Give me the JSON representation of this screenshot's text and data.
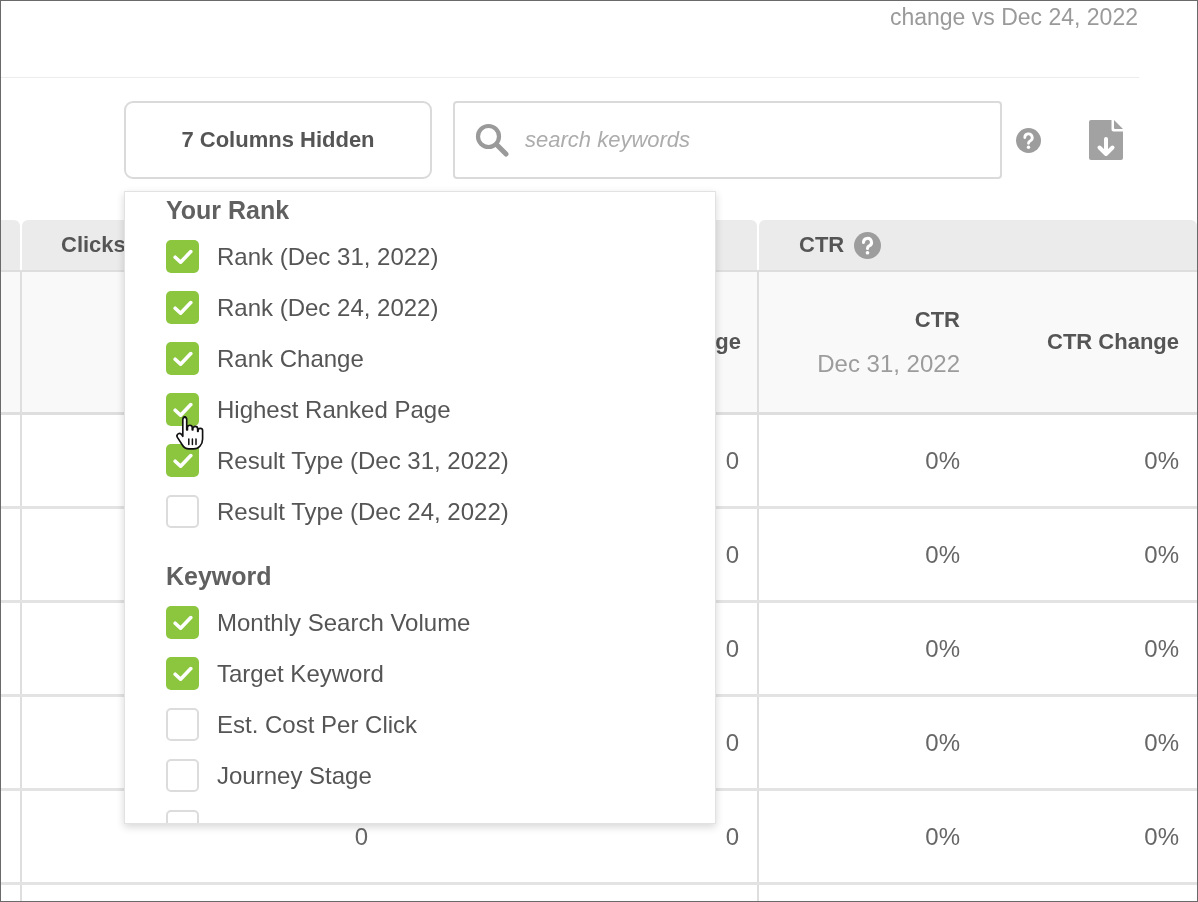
{
  "header": {
    "comparison": "change vs Dec 24, 2022"
  },
  "toolbar": {
    "columns_button": "7 Columns Hidden",
    "search": {
      "placeholder": "search keywords"
    },
    "column_menu": {
      "groups": [
        {
          "title": "Your Rank",
          "items": [
            {
              "label": "Rank (Dec 31, 2022)",
              "checked": true
            },
            {
              "label": "Rank (Dec 24, 2022)",
              "checked": true
            },
            {
              "label": "Rank Change",
              "checked": true
            },
            {
              "label": "Highest Ranked Page",
              "checked": true
            },
            {
              "label": "Result Type (Dec 31, 2022)",
              "checked": true
            },
            {
              "label": "Result Type (Dec 24, 2022)",
              "checked": false
            }
          ]
        },
        {
          "title": "Keyword",
          "items": [
            {
              "label": "Monthly Search Volume",
              "checked": true
            },
            {
              "label": "Target Keyword",
              "checked": true
            },
            {
              "label": "Est. Cost Per Click",
              "checked": false
            },
            {
              "label": "Journey Stage",
              "checked": false
            },
            {
              "checked": false
            }
          ]
        }
      ]
    }
  },
  "table": {
    "column_groups": [
      {
        "kind": "stub"
      },
      {
        "kind": "group",
        "label": "Clicks"
      },
      {
        "kind": "group",
        "label": "CTR",
        "info_icon": true
      }
    ],
    "columns": [
      {
        "kind": "stub"
      },
      {
        "kind": "metric"
      },
      {
        "kind": "metric",
        "title": "ge"
      },
      {
        "kind": "metric",
        "title": "CTR",
        "subtitle": "Dec 31, 2022"
      },
      {
        "kind": "metric",
        "title": "CTR Change"
      }
    ],
    "rows": [
      {
        "column_2": "0",
        "column_3": "0%",
        "column_4": "0%"
      },
      {
        "column_2": "0",
        "column_3": "0%",
        "column_4": "0%"
      },
      {
        "column_2": "0",
        "column_3": "0%",
        "column_4": "0%"
      },
      {
        "column_2": "0",
        "column_3": "0%",
        "column_4": "0%"
      },
      {
        "column_1": "0",
        "column_2": "0",
        "column_3": "0%",
        "column_4": "0%"
      }
    ]
  }
}
